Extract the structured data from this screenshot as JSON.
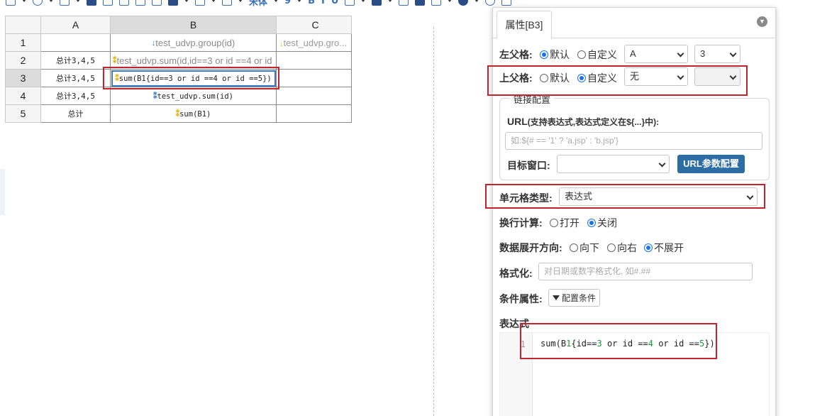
{
  "toolbar": {
    "icons": [
      "zoom-icon",
      "undo-icon",
      "save-icon",
      "folder-icon",
      "print-icon",
      "cut-icon",
      "copy-icon",
      "paste-icon",
      "underline-icon",
      "border-icon",
      "table-icon",
      "font-icon",
      "bold-icon",
      "italic-icon",
      "underline-icon",
      "font-size-icon",
      "font-color-icon",
      "image-icon",
      "chart-icon",
      "barcode-icon",
      "globe-icon",
      "settings-icon",
      "list-icon"
    ],
    "font_name": "宋体",
    "bold_label": "B",
    "italic_label": "I",
    "underline_label": "U"
  },
  "sheet": {
    "column_headers": [
      "A",
      "B",
      "C"
    ],
    "selected_column": "B",
    "selected_row": "3",
    "rows": [
      {
        "num": "1",
        "a": "",
        "b": "test_udvp.group(id)",
        "c": "test_udvp.gro..."
      },
      {
        "num": "2",
        "a": "总计3,4,5",
        "b": "test_udvp.sum(id,id==3 or id ==4 or id",
        "c": ""
      },
      {
        "num": "3",
        "a": "总计3,4,5",
        "b": "sum(B1{id==3 or id ==4 or id ==5})",
        "c": ""
      },
      {
        "num": "4",
        "a": "总计3,4,5",
        "b": "test_udvp.sum(id)",
        "c": ""
      },
      {
        "num": "5",
        "a": "总计",
        "b": "sum(B1)",
        "c": ""
      }
    ]
  },
  "panel": {
    "tab_label": "属性[B3]",
    "left_parent": {
      "label": "左父格:",
      "option_default": "默认",
      "option_custom": "自定义",
      "selected": "默认",
      "column_value": "A",
      "row_value": "3"
    },
    "top_parent": {
      "label": "上父格:",
      "option_default": "默认",
      "option_custom": "自定义",
      "selected": "自定义",
      "column_value": "无",
      "row_value": ""
    },
    "link_config": {
      "legend": "链接配置",
      "url_label": "URL",
      "url_hint": "(支持表达式,表达式定义在${...}中):",
      "url_placeholder": "如:${# == '1' ? 'a.jsp' : 'b.jsp'}",
      "target_label": "目标窗口:",
      "target_value": "",
      "url_param_button": "URL参数配置"
    },
    "cell_type": {
      "label": "单元格类型:",
      "value": "表达式"
    },
    "line_calc": {
      "label": "换行计算:",
      "option_on": "打开",
      "option_off": "关闭",
      "selected": "关闭"
    },
    "expand_dir": {
      "label": "数据展开方向:",
      "option_down": "向下",
      "option_right": "向右",
      "option_none": "不展开",
      "selected": "不展开"
    },
    "format": {
      "label": "格式化:",
      "placeholder": "对日期或数字格式化, 如#.##"
    },
    "condition": {
      "label": "条件属性:",
      "button": "配置条件"
    },
    "expression": {
      "label": "表达式",
      "line_number": "1",
      "code": "sum(B1{id==3 or id ==4 or id ==5})"
    }
  },
  "colors": {
    "highlight_red": "#c0242c",
    "primary_blue": "#2e6da4",
    "selection_blue": "#3b7ac9"
  }
}
